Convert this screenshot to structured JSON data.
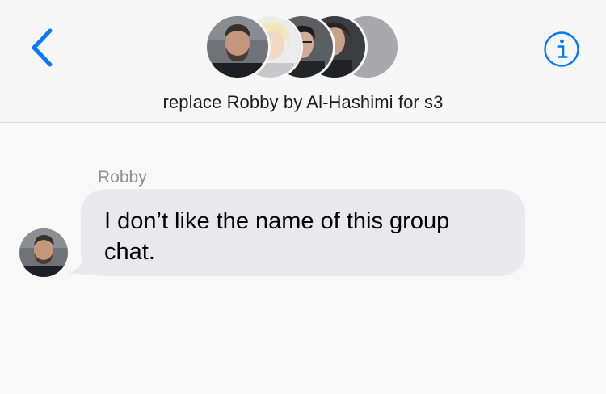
{
  "header": {
    "back_icon": "chevron-left-icon",
    "info_icon": "info-icon",
    "group_name": "replace Robby by Al-Hashimi for s3",
    "accent_color": "#007aff",
    "participant_count_shown": 5
  },
  "thread": {
    "messages": [
      {
        "sender": "Robby",
        "text": "I don’t like the name of this group chat.",
        "bubble_color": "#e9e9eb"
      }
    ]
  }
}
